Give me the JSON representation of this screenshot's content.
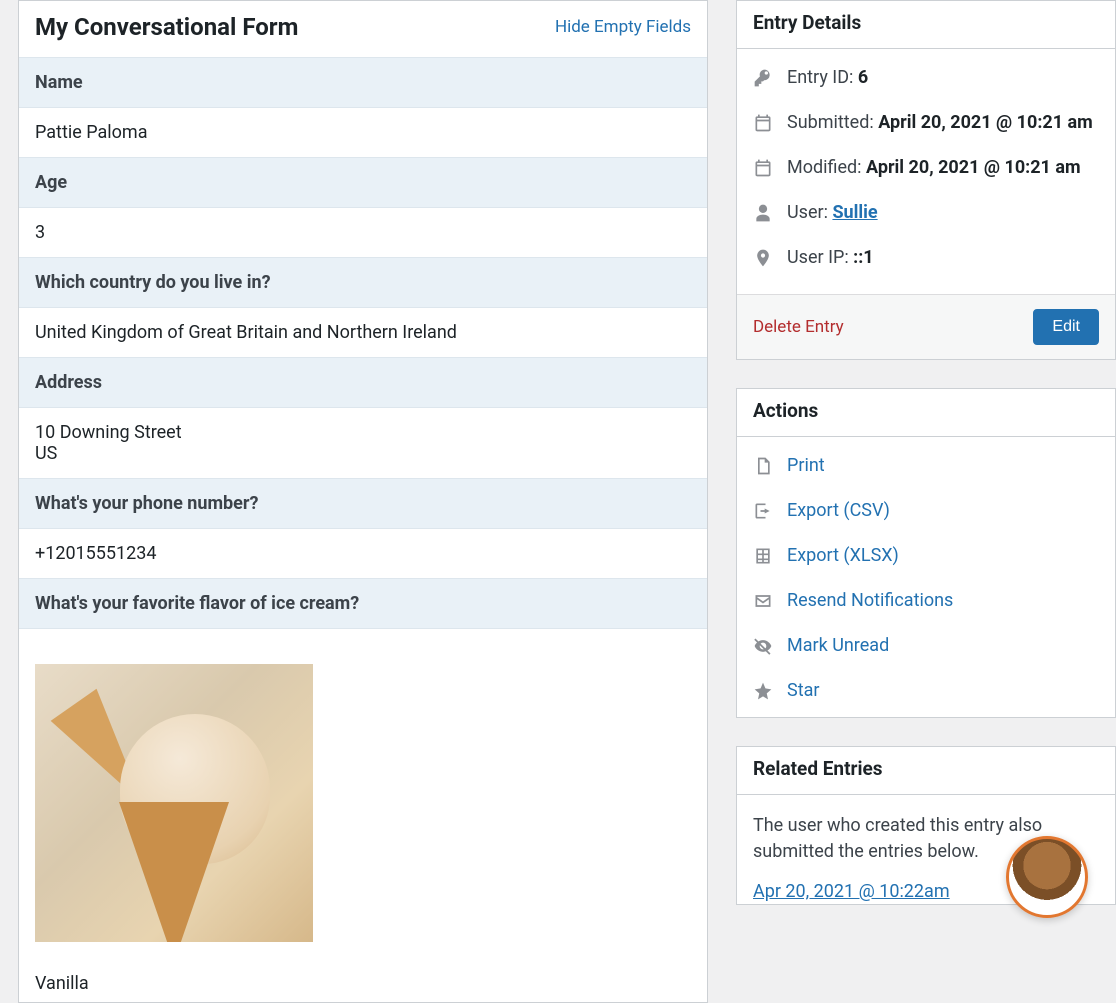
{
  "form": {
    "title": "My Conversational Form",
    "hide_fields_label": "Hide Empty Fields",
    "fields": [
      {
        "label": "Name",
        "value": "Pattie Paloma"
      },
      {
        "label": "Age",
        "value": "3"
      },
      {
        "label": "Which country do you live in?",
        "value": "United Kingdom of Great Britain and Northern Ireland"
      },
      {
        "label": "Address",
        "value": "10 Downing Street\nUS"
      },
      {
        "label": "What's your phone number?",
        "value": "+12015551234"
      },
      {
        "label": "What's your favorite flavor of ice cream?",
        "value": "Vanilla",
        "has_image": true
      }
    ]
  },
  "entry_details": {
    "title": "Entry Details",
    "id_label": "Entry ID: ",
    "id_value": "6",
    "submitted_label": "Submitted: ",
    "submitted_value": "April 20, 2021 @ 10:21 am",
    "modified_label": "Modified: ",
    "modified_value": "April 20, 2021 @ 10:21 am",
    "user_label": "User: ",
    "user_value": "Sullie",
    "ip_label": "User IP: ",
    "ip_value": "::1",
    "delete_label": "Delete Entry",
    "edit_label": "Edit"
  },
  "actions": {
    "title": "Actions",
    "items": [
      {
        "label": "Print"
      },
      {
        "label": "Export (CSV)"
      },
      {
        "label": "Export (XLSX)"
      },
      {
        "label": "Resend Notifications"
      },
      {
        "label": "Mark Unread"
      },
      {
        "label": "Star"
      }
    ]
  },
  "related": {
    "title": "Related Entries",
    "description": "The user who created this entry also submitted the entries below.",
    "link_label": "Apr 20, 2021 @ 10:22am"
  }
}
